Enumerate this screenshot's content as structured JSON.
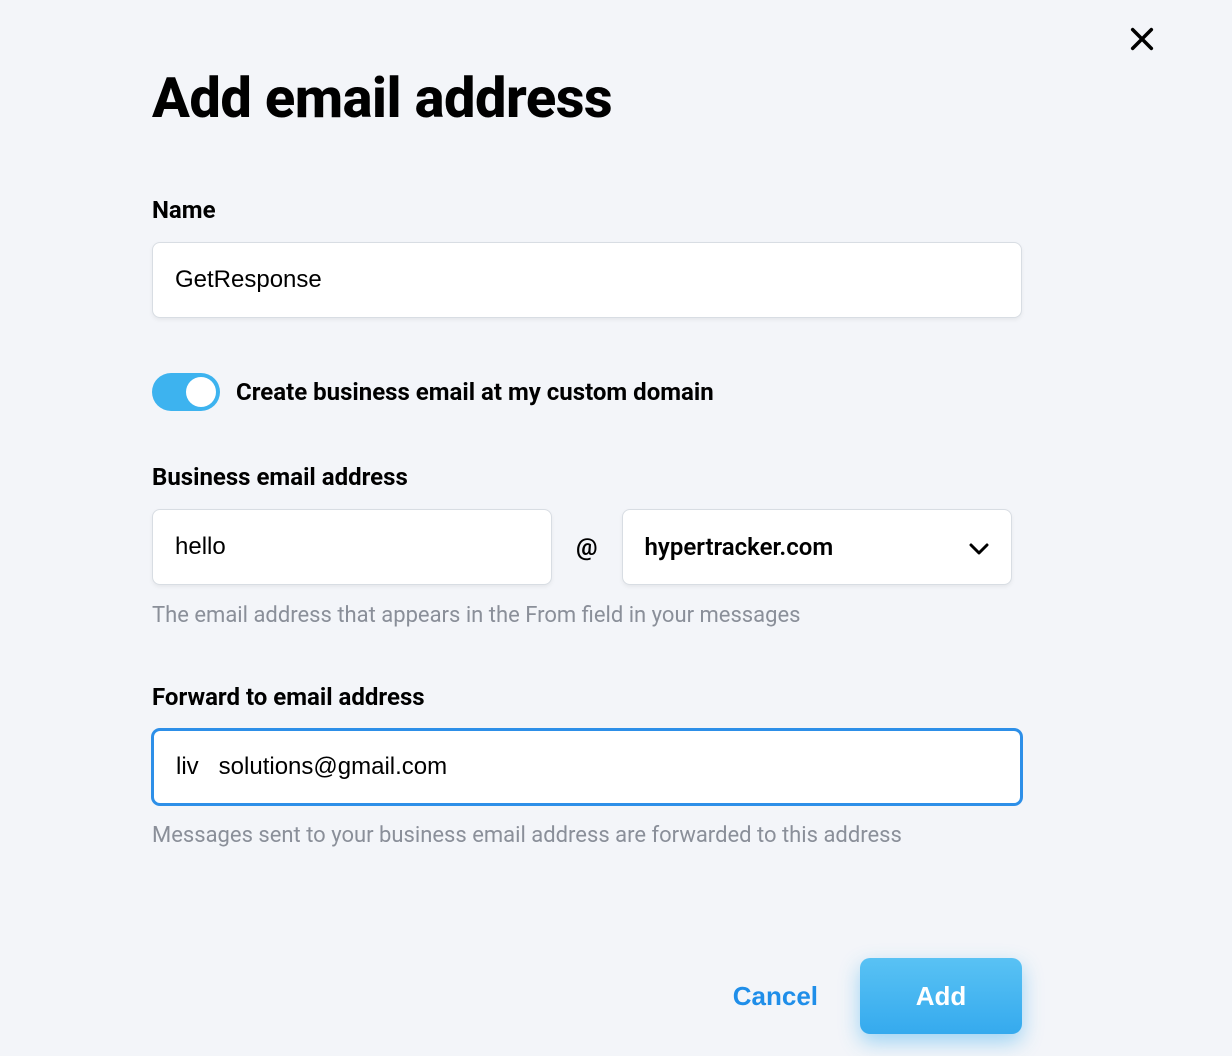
{
  "modal": {
    "title": "Add email address",
    "close_icon": "close"
  },
  "name_field": {
    "label": "Name",
    "value": "GetResponse"
  },
  "toggle": {
    "label": "Create business email at my custom domain",
    "state": "on"
  },
  "business_email": {
    "label": "Business email address",
    "local_value": "hello",
    "at": "@",
    "domain_value": "hypertracker.com",
    "helper": "The email address that appears in the From field in your messages"
  },
  "forward_email": {
    "label": "Forward to email address",
    "value": "liv   solutions@gmail.com",
    "helper": "Messages sent to your business email address are forwarded to this address"
  },
  "buttons": {
    "cancel": "Cancel",
    "add": "Add"
  }
}
